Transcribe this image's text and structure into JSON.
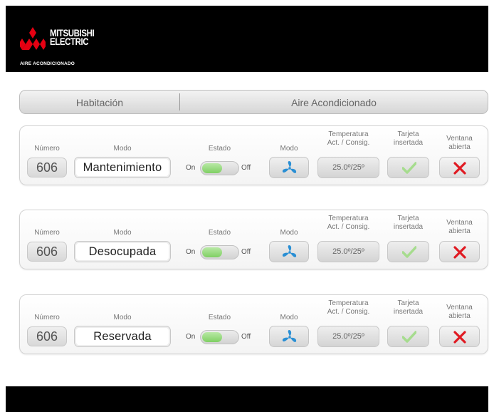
{
  "brand": {
    "line1": "MITSUBISHI",
    "line2": "ELECTRIC",
    "sub": "AIRE ACONDICIONADO"
  },
  "header": {
    "col1": "Habitación",
    "col2": "Aire Acondicionado"
  },
  "labels": {
    "numero": "Número",
    "modo": "Modo",
    "estado": "Estado",
    "modo_ac": "Modo",
    "temp_line1": "Temperatura",
    "temp_line2": "Act. / Consig.",
    "tarjeta_line1": "Tarjeta",
    "tarjeta_line2": "insertada",
    "ventana_line1": "Ventana",
    "ventana_line2": "abierta",
    "on": "On",
    "off": "Off"
  },
  "rooms": [
    {
      "numero": "606",
      "modo": "Mantenimiento",
      "estado_on": true,
      "ac_mode_icon": "fan-icon",
      "temperatura": "25.0º/25º",
      "tarjeta_insertada": true,
      "ventana_abierta": true
    },
    {
      "numero": "606",
      "modo": "Desocupada",
      "estado_on": true,
      "ac_mode_icon": "fan-icon",
      "temperatura": "25.0º/25º",
      "tarjeta_insertada": true,
      "ventana_abierta": true
    },
    {
      "numero": "606",
      "modo": "Reservada",
      "estado_on": true,
      "ac_mode_icon": "fan-icon",
      "temperatura": "25.0º/25º",
      "tarjeta_insertada": true,
      "ventana_abierta": true
    }
  ],
  "colors": {
    "fan": "#2a8fd4",
    "check": "#a6dc8e",
    "x": "#e01a22",
    "toggle_on": "#7fcf63"
  }
}
